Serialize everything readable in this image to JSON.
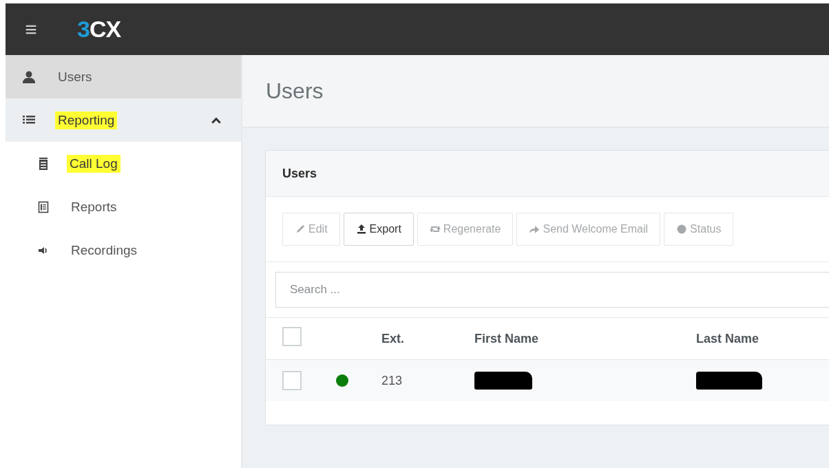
{
  "topbar": {
    "menu_icon": "≡",
    "logo": [
      {
        "text": "3",
        "color": "#1e9bd7"
      },
      {
        "text": "CX",
        "color": "#ffffff"
      }
    ]
  },
  "sidebar": {
    "items": [
      {
        "label": "Users",
        "selected": true,
        "highlighted": false
      },
      {
        "label": "Reporting",
        "selected": false,
        "highlighted": true,
        "expanded": true,
        "children": [
          {
            "label": "Call Log",
            "selected": false,
            "highlighted": true
          },
          {
            "label": "Reports",
            "selected": false,
            "highlighted": false
          },
          {
            "label": "Recordings",
            "selected": false,
            "highlighted": false
          }
        ]
      }
    ]
  },
  "page_title": "Users",
  "card": {
    "title": "Users",
    "toolbar": [
      {
        "label": "Edit",
        "disabled": true
      },
      {
        "label": "Export",
        "disabled": false
      },
      {
        "label": "Regenerate",
        "disabled": true
      },
      {
        "label": "Send Welcome Email",
        "disabled": true
      },
      {
        "label": "Status",
        "disabled": true
      }
    ],
    "search": {
      "placeholder": "Search ..."
    },
    "table": {
      "header_checkbox": {
        "checked": false
      },
      "columns": [
        "Ext.",
        "First Name",
        "Last Name"
      ],
      "rows": [
        {
          "checked": false,
          "color": "#0a7d0a",
          "cells": [
            {
              "kind": "text",
              "text": "213"
            },
            {
              "kind": "redacted"
            },
            {
              "kind": "redacted"
            }
          ]
        }
      ]
    }
  }
}
